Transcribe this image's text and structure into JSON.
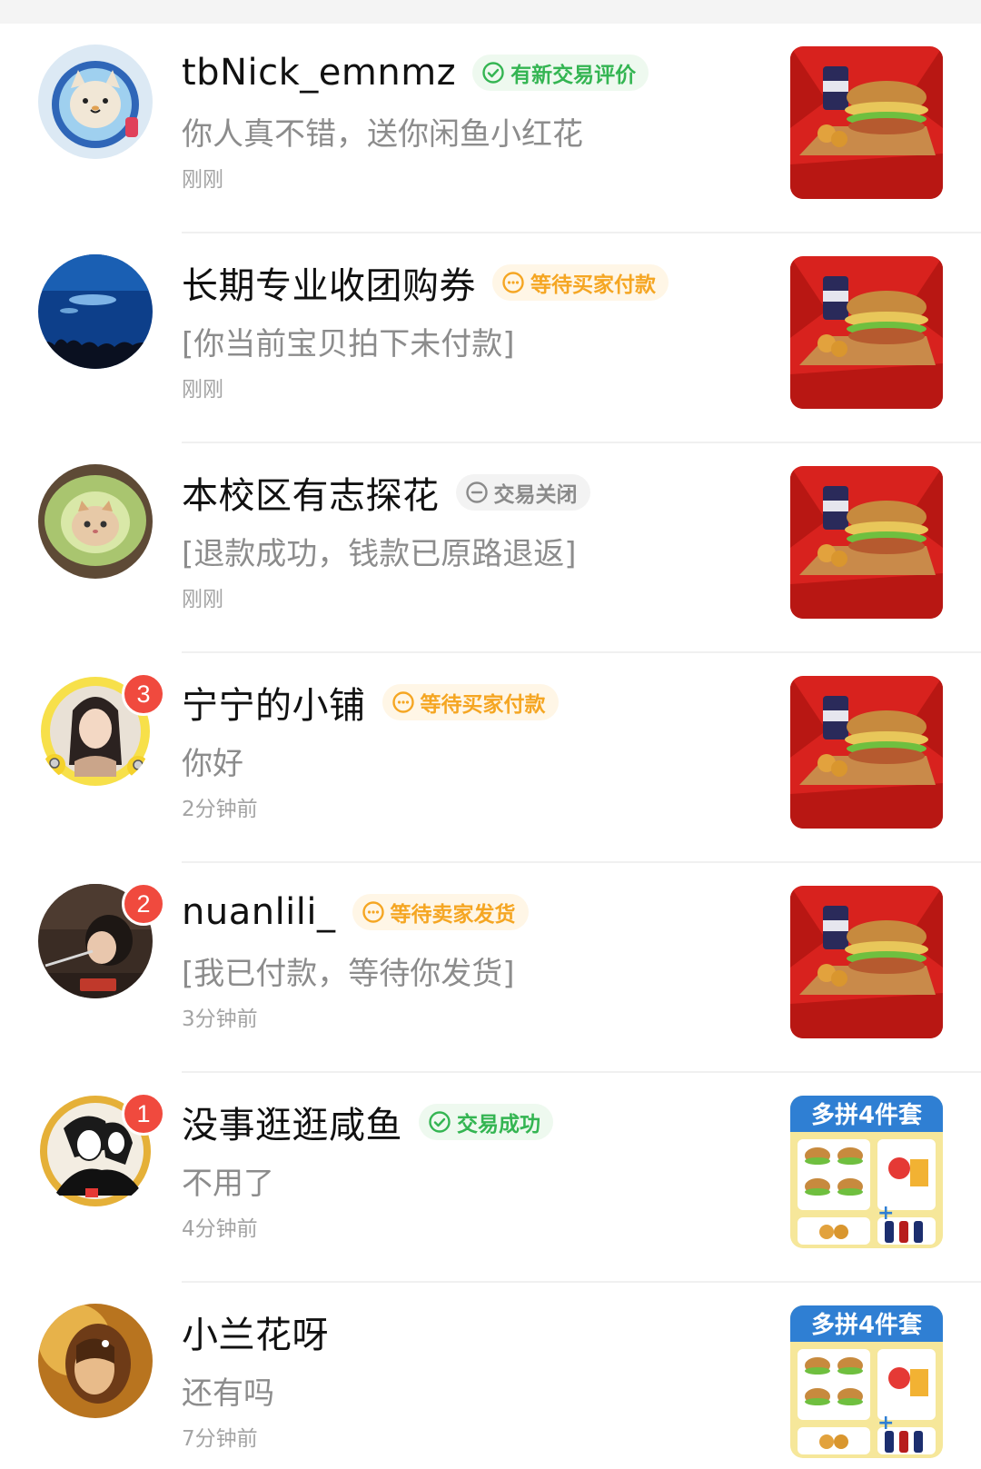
{
  "conversations": [
    {
      "name": "tbNick_emnmz",
      "tag": "有新交易评价",
      "tag_style": "green",
      "tag_icon": "check-circle-icon",
      "message": "你人真不错，送你闲鱼小红花",
      "time": "刚刚",
      "unread": "",
      "avatar": "astronaut-cat-avatar",
      "thumb": "burger-meal"
    },
    {
      "name": "长期专业收团购券",
      "tag": "等待买家付款",
      "tag_style": "orange",
      "tag_icon": "dots-circle-icon",
      "message": "[你当前宝贝拍下未付款]",
      "time": "刚刚",
      "unread": "",
      "avatar": "aquarium-avatar",
      "thumb": "burger-meal"
    },
    {
      "name": "本校区有志探花",
      "tag": "交易关闭",
      "tag_style": "grey",
      "tag_icon": "minus-circle-icon",
      "message": "[退款成功，钱款已原路退返]",
      "time": "刚刚",
      "unread": "",
      "avatar": "avocado-cat-avatar",
      "thumb": "burger-meal"
    },
    {
      "name": "宁宁的小铺",
      "tag": "等待买家付款",
      "tag_style": "orange",
      "tag_icon": "dots-circle-icon",
      "message": "你好",
      "time": "2分钟前",
      "unread": "3",
      "avatar": "girl-minions-avatar",
      "thumb": "burger-meal"
    },
    {
      "name": "nuanlili_",
      "tag": "等待卖家发货",
      "tag_style": "orange",
      "tag_icon": "dots-circle-icon",
      "message": "[我已付款，等待你发货]",
      "time": "3分钟前",
      "unread": "2",
      "avatar": "child-photo-avatar",
      "thumb": "burger-meal"
    },
    {
      "name": "没事逛逛咸鱼",
      "tag": "交易成功",
      "tag_style": "green",
      "tag_icon": "check-circle-icon",
      "message": "不用了",
      "time": "4分钟前",
      "unread": "1",
      "avatar": "anime-avatar",
      "thumb": "combo-set"
    },
    {
      "name": "小兰花呀",
      "tag": "",
      "tag_style": "",
      "tag_icon": "",
      "message": "还有吗",
      "time": "7分钟前",
      "unread": "",
      "avatar": "warm-portrait-avatar",
      "thumb": "combo-set"
    }
  ],
  "thumb_text": {
    "combo_title": "多拼4件套"
  },
  "colors": {
    "green": "#34b552",
    "orange": "#f5a623",
    "grey": "#8a8a8a",
    "badge": "#f04a3e",
    "thumb_red": "#d8221e"
  }
}
